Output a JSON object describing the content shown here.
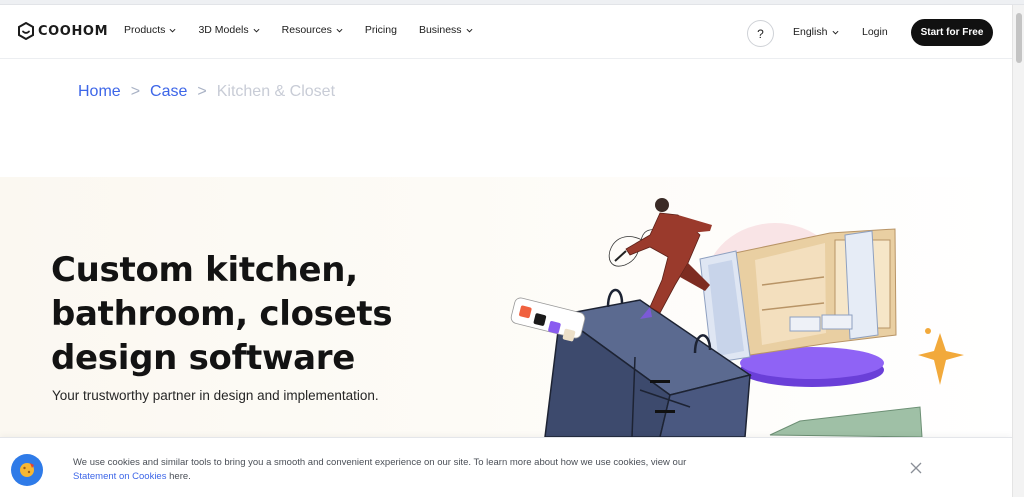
{
  "brand": {
    "name": "COOHOM"
  },
  "nav": {
    "items": [
      {
        "label": "Products",
        "has_dropdown": true
      },
      {
        "label": "3D Models",
        "has_dropdown": true
      },
      {
        "label": "Resources",
        "has_dropdown": true
      },
      {
        "label": "Pricing",
        "has_dropdown": false
      },
      {
        "label": "Business",
        "has_dropdown": true
      }
    ],
    "help_label": "?",
    "language": "English",
    "login": "Login",
    "cta": "Start for Free"
  },
  "breadcrumb": {
    "items": [
      {
        "label": "Home",
        "link": true
      },
      {
        "label": "Case",
        "link": true
      },
      {
        "label": "Kitchen & Closet",
        "link": false
      }
    ],
    "separator": ">"
  },
  "hero": {
    "title_lines": [
      "Custom kitchen,",
      "bathroom, closets",
      "design software"
    ],
    "subtitle": "Your trustworthy partner in design and implementation."
  },
  "cookie": {
    "text_before": "We use cookies and similar tools to bring you a smooth and convenient experience on our site. To learn more about how we use cookies, view our ",
    "link_text": "Statement on Cookies",
    "text_after": " here."
  },
  "colors": {
    "accent": "#3d66e8",
    "cta_bg": "#111111",
    "platform_purple": "#7b4dee",
    "figure_suit": "#9a3a2c",
    "cabinet_navy": "#3d4a6d",
    "wood": "#e9cfa2",
    "sparkle": "#f2a93b",
    "cookie_icon_bg": "#2f7be8"
  },
  "icons": {
    "logo": "coohom-logo-icon",
    "dropdown": "chevron-down-icon",
    "close": "close-icon",
    "cookie": "cookie-icon"
  }
}
